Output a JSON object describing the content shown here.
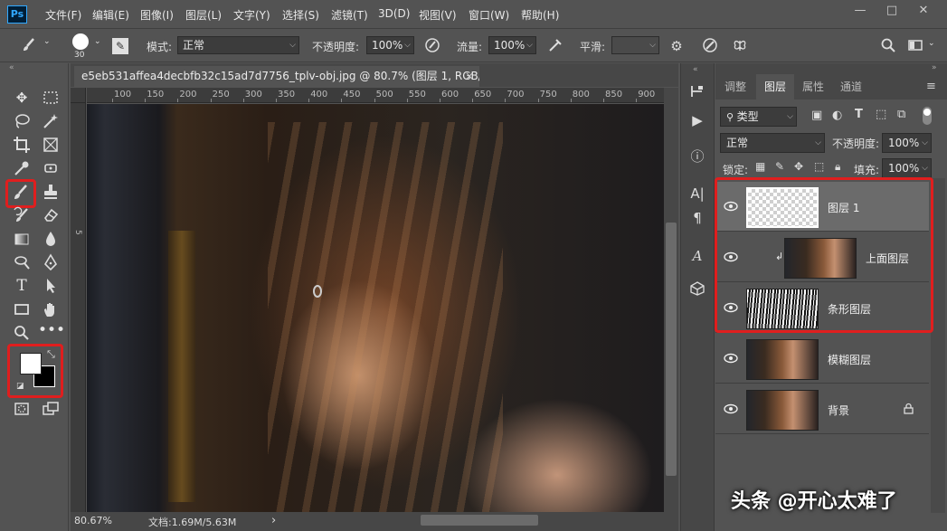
{
  "menubar": {
    "logo": "Ps",
    "items": [
      "文件(F)",
      "编辑(E)",
      "图像(I)",
      "图层(L)",
      "文字(Y)",
      "选择(S)",
      "滤镜(T)",
      "3D(D)",
      "视图(V)",
      "窗口(W)",
      "帮助(H)"
    ],
    "window_controls": [
      "—",
      "□",
      "✕"
    ]
  },
  "options": {
    "brush_size": "30",
    "mode_label": "模式:",
    "mode_value": "正常",
    "opacity_label": "不透明度:",
    "opacity_value": "100%",
    "flow_label": "流量:",
    "flow_value": "100%",
    "smoothing_label": "平滑:",
    "smoothing_value": ""
  },
  "document": {
    "tab_title": "e5eb531affea4decbfb32c15ad7d7756_tplv-obj.jpg @ 80.7% (图层 1, RGB/8) *",
    "close_label": "×",
    "ruler_labels": [
      "100",
      "150",
      "200",
      "250",
      "300",
      "350",
      "400",
      "450",
      "500",
      "550",
      "600",
      "650",
      "700",
      "750",
      "800",
      "850",
      "900"
    ],
    "zoom": "80.67%",
    "doc_info": "文档:1.69M/5.63M",
    "status_arrow": "›"
  },
  "layers_panel": {
    "tabs": [
      "调整",
      "图层",
      "属性",
      "通道"
    ],
    "active_tab": "图层",
    "filter_kind": "类型",
    "blend_mode": "正常",
    "opacity_label": "不透明度:",
    "opacity_value": "100%",
    "lock_label": "锁定:",
    "fill_label": "填充:",
    "fill_value": "100%",
    "layers": [
      {
        "name": "图层 1",
        "selected": true,
        "locked": false,
        "clipped": false
      },
      {
        "name": "上面图层",
        "selected": false,
        "locked": false,
        "clipped": true
      },
      {
        "name": "条形图层",
        "selected": false,
        "locked": false,
        "clipped": false
      },
      {
        "name": "模糊图层",
        "selected": false,
        "locked": false,
        "clipped": false
      },
      {
        "name": "背景",
        "selected": false,
        "locked": true,
        "clipped": false
      }
    ]
  },
  "watermark": "头条 @开心太难了",
  "colors": {
    "highlight_red": "#e01e1e",
    "foreground_swatch": "#ffffff",
    "background_swatch": "#000000"
  }
}
